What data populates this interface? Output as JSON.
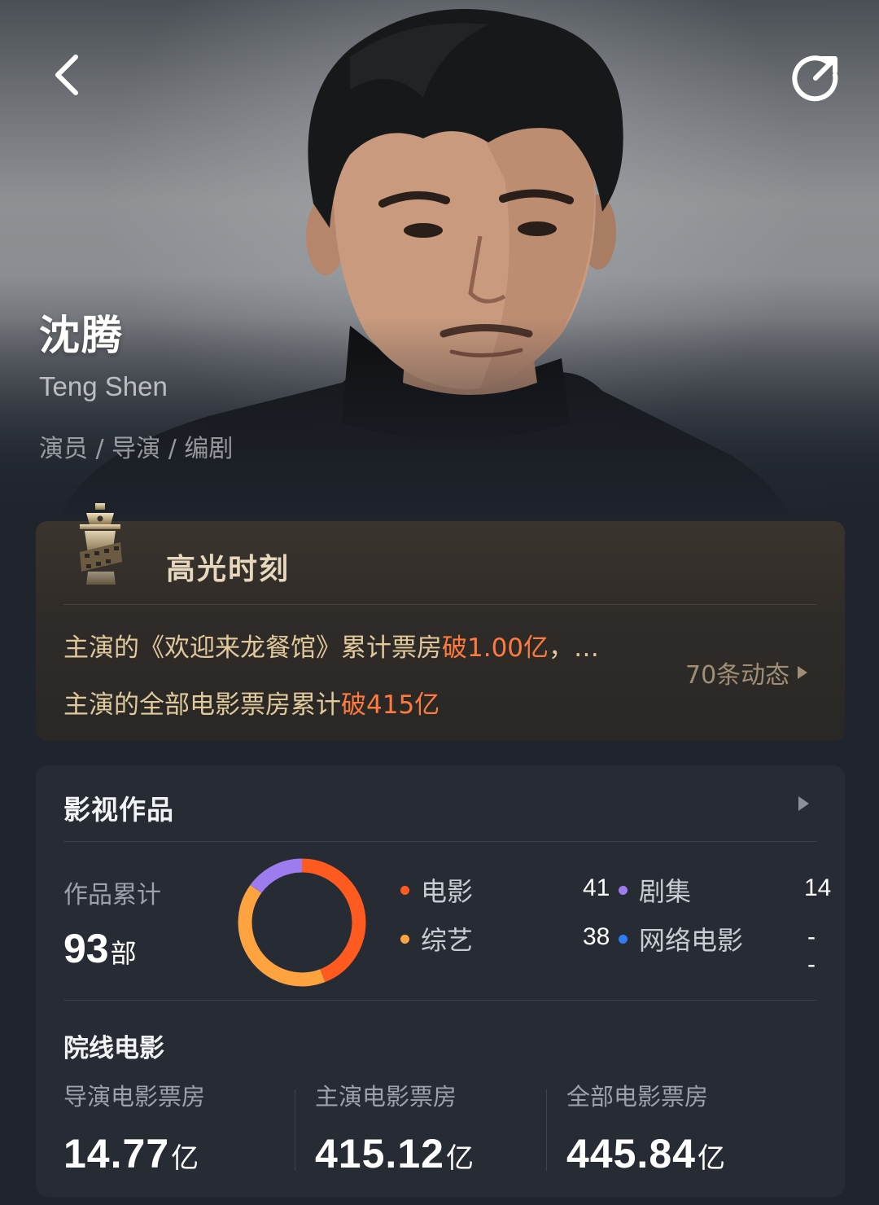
{
  "profile": {
    "name_cn": "沈腾",
    "name_en": "Teng Shen",
    "roles": "演员 / 导演 / 编剧"
  },
  "icons": {
    "back": "chevron-left-icon",
    "share": "share-icon",
    "highlight": "lighthouse-film-icon"
  },
  "highlight": {
    "title": "高光时刻",
    "line1": {
      "prefix": "主演的《欢迎来龙餐馆》累计票房",
      "hot": "破1.00亿",
      "suffix": "，…"
    },
    "line2": {
      "prefix": "主演的全部电影票房累计",
      "hot": "破415亿"
    },
    "more_label": "70条动态"
  },
  "works": {
    "title": "影视作品",
    "total_label": "作品累计",
    "total_value": "93",
    "total_unit": "部",
    "categories": [
      {
        "name": "电影",
        "value": "41",
        "count": 41,
        "color": "#ff5a1f"
      },
      {
        "name": "剧集",
        "value": "14",
        "count": 14,
        "color": "#9d7cf0"
      },
      {
        "name": "综艺",
        "value": "38",
        "count": 38,
        "color": "#ffa340"
      },
      {
        "name": "网络电影",
        "value": "--",
        "count": 0,
        "color": "#2f7cf6"
      }
    ],
    "theater": {
      "title": "院线电影",
      "stats": [
        {
          "label": "导演电影票房",
          "value": "14.77",
          "unit": "亿"
        },
        {
          "label": "主演电影票房",
          "value": "415.12",
          "unit": "亿"
        },
        {
          "label": "全部电影票房",
          "value": "445.84",
          "unit": "亿"
        }
      ]
    }
  },
  "colors": {
    "background": "#1f242d",
    "card": "#272b33",
    "highlight_text": "#e0c99b",
    "highlight_hot": "#ff7a3e"
  }
}
